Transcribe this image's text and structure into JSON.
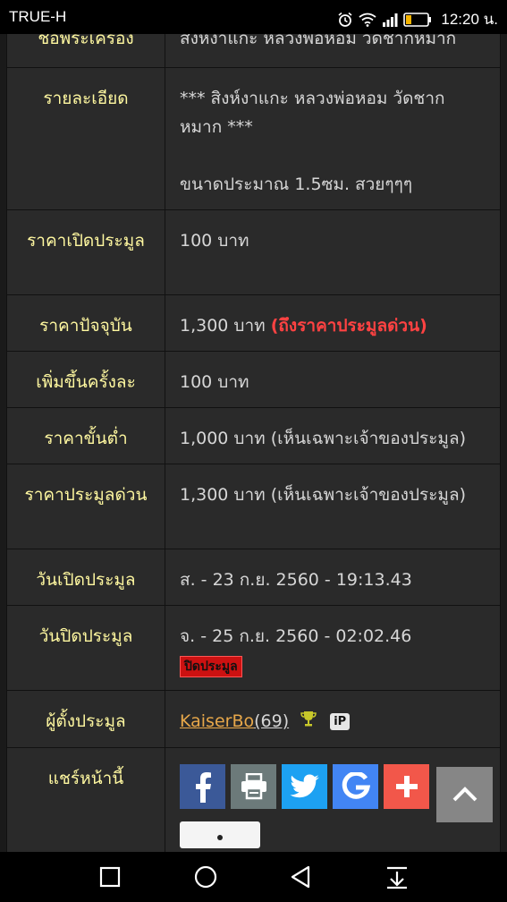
{
  "status_bar": {
    "carrier": "TRUE-H",
    "time": "12:20 น."
  },
  "rows": {
    "top_partial": {
      "label": "ชื่อพระเครื่อง",
      "value": "สิงห์งาแกะ หลวงพ่อหอม วัดชากหมาก"
    },
    "details": {
      "label": "รายละเอียด",
      "line1": "*** สิงห์งาแกะ หลวงพ่อหอม วัดชาก",
      "line2": "หมาก ***",
      "line3": "ขนาดประมาณ 1.5ซม. สวยๆๆๆ"
    },
    "opening_price": {
      "label": "ราคาเปิดประมูล",
      "value": "100 บาท"
    },
    "current_price": {
      "label": "ราคาปัจจุบัน",
      "value": "1,300 บาท",
      "note": "(ถึงราคาประมูลด่วน)"
    },
    "increment": {
      "label": "เพิ่มขึ้นครั้งละ",
      "value": "100 บาท"
    },
    "min_price": {
      "label": "ราคาขั้นต่ำ",
      "value": "1,000 บาท (เห็นเฉพาะเจ้าของประมูล)"
    },
    "buy_now_price": {
      "label": "ราคาประมูลด่วน",
      "value": "1,300 บาท (เห็นเฉพาะเจ้าของประมูล)"
    },
    "open_date": {
      "label": "วันเปิดประมูล",
      "value": "ส. - 23 ก.ย. 2560 - 19:13.43"
    },
    "close_date": {
      "label": "วันปิดประมูล",
      "value": "จ. - 25 ก.ย. 2560 - 02:02.46",
      "badge": "ปิดประมูล"
    },
    "seller": {
      "label": "ผู้ตั้งประมูล",
      "username": "KaiserBo",
      "score": "(69)",
      "ip_badge": "iP"
    },
    "share": {
      "label": "แชร์หน้านี้"
    }
  },
  "share_buttons": [
    {
      "name": "facebook",
      "icon": "facebook-icon",
      "color": "#3b5998"
    },
    {
      "name": "print",
      "icon": "printer-icon",
      "color": "#6c7a7a"
    },
    {
      "name": "twitter",
      "icon": "twitter-icon",
      "color": "#1da1f2"
    },
    {
      "name": "google",
      "icon": "google-icon",
      "color": "#4285f4"
    },
    {
      "name": "more",
      "icon": "plus-icon",
      "color": "#f2574a"
    }
  ],
  "colors": {
    "label_text": "#fff8a0",
    "value_text": "#d6d6d6",
    "accent_red": "#ff4242",
    "link_orange": "#e8a84a",
    "cell_bg": "#2a2a2a"
  }
}
